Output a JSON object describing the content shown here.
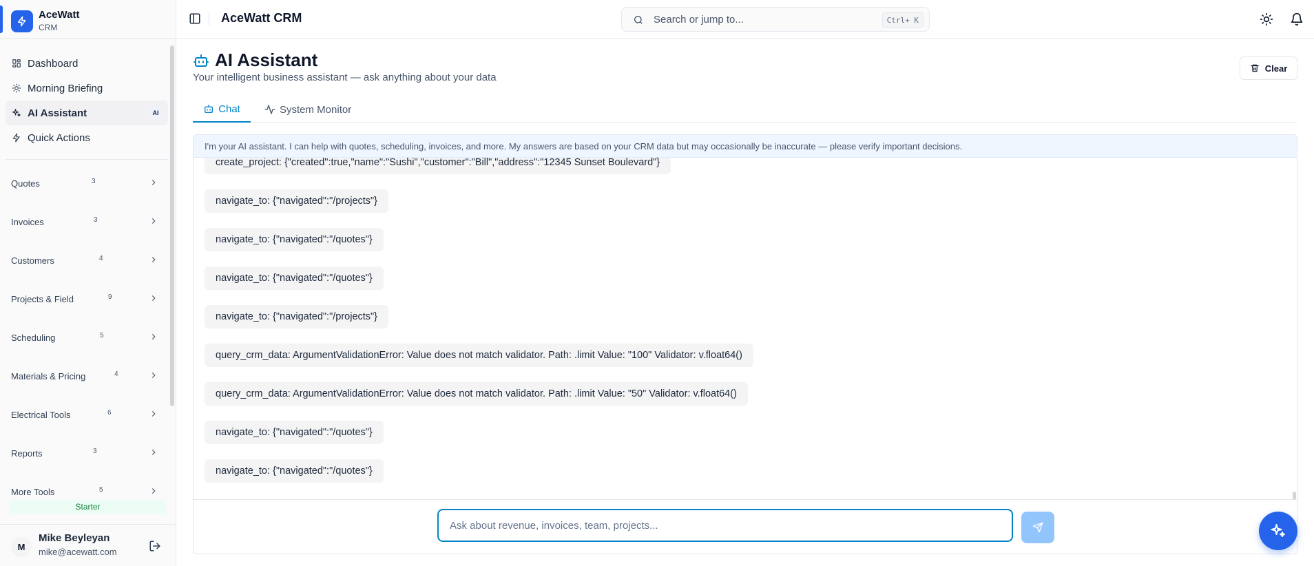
{
  "brand": {
    "name": "AceWatt",
    "sub": "CRM"
  },
  "nav": [
    {
      "label": "Dashboard",
      "icon": "dashboard-icon"
    },
    {
      "label": "Morning Briefing",
      "icon": "sun-icon"
    },
    {
      "label": "AI Assistant",
      "icon": "sparkles-icon",
      "badge": "AI",
      "active": true
    },
    {
      "label": "Quick Actions",
      "icon": "zap-icon"
    }
  ],
  "groups": [
    {
      "label": "Quotes",
      "count": "3"
    },
    {
      "label": "Invoices",
      "count": "3"
    },
    {
      "label": "Customers",
      "count": "4"
    },
    {
      "label": "Projects & Field",
      "count": "9"
    },
    {
      "label": "Scheduling",
      "count": "5"
    },
    {
      "label": "Materials & Pricing",
      "count": "4"
    },
    {
      "label": "Electrical Tools",
      "count": "6"
    },
    {
      "label": "Reports",
      "count": "3"
    },
    {
      "label": "More Tools",
      "count": "5"
    }
  ],
  "plan": "Starter",
  "user": {
    "initial": "M",
    "name": "Mike Beyleyan",
    "email": "mike@acewatt.com"
  },
  "header": {
    "title": "AceWatt CRM",
    "search_placeholder": "Search or jump to...",
    "shortcut": "Ctrl+ K"
  },
  "page": {
    "title": "AI Assistant",
    "subtitle": "Your intelligent business assistant — ask anything about your data",
    "clear_label": "Clear"
  },
  "tabs": [
    {
      "label": "Chat",
      "active": true
    },
    {
      "label": "System Monitor",
      "active": false
    }
  ],
  "chat": {
    "notice": "I'm your AI assistant. I can help with quotes, scheduling, invoices, and more. My answers are based on your CRM data but may occasionally be inaccurate — please verify important decisions.",
    "messages": [
      "create_project: {\"created\":true,\"name\":\"Sushi\",\"customer\":\"Bill\",\"address\":\"12345 Sunset Boulevard\"}",
      "navigate_to: {\"navigated\":\"/projects\"}",
      "navigate_to: {\"navigated\":\"/quotes\"}",
      "navigate_to: {\"navigated\":\"/quotes\"}",
      "navigate_to: {\"navigated\":\"/projects\"}",
      "query_crm_data: ArgumentValidationError: Value does not match validator. Path: .limit Value: \"100\" Validator: v.float64()",
      "query_crm_data: ArgumentValidationError: Value does not match validator. Path: .limit Value: \"50\" Validator: v.float64()",
      "navigate_to: {\"navigated\":\"/quotes\"}",
      "navigate_to: {\"navigated\":\"/quotes\"}"
    ],
    "input_placeholder": "Ask about revenue, invoices, team, projects...",
    "input_value": ""
  },
  "colors": {
    "accent": "#2563eb",
    "tab_active": "#0284c7",
    "send_disabled": "#93c5fd"
  }
}
